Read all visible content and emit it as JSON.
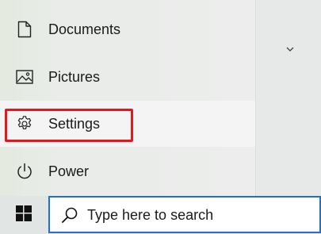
{
  "start_menu": {
    "items": [
      {
        "label": "Documents",
        "icon": "document-icon"
      },
      {
        "label": "Pictures",
        "icon": "pictures-icon"
      },
      {
        "label": "Settings",
        "icon": "gear-icon"
      },
      {
        "label": "Power",
        "icon": "power-icon"
      }
    ]
  },
  "tiles": {
    "expand_icon": "chevron-down-icon"
  },
  "taskbar": {
    "start_icon": "windows-logo-icon",
    "search": {
      "text": "Type here to search",
      "icon": "search-icon"
    }
  },
  "colors": {
    "highlight_border": "#e5161c",
    "search_border": "#1f6fd6"
  }
}
